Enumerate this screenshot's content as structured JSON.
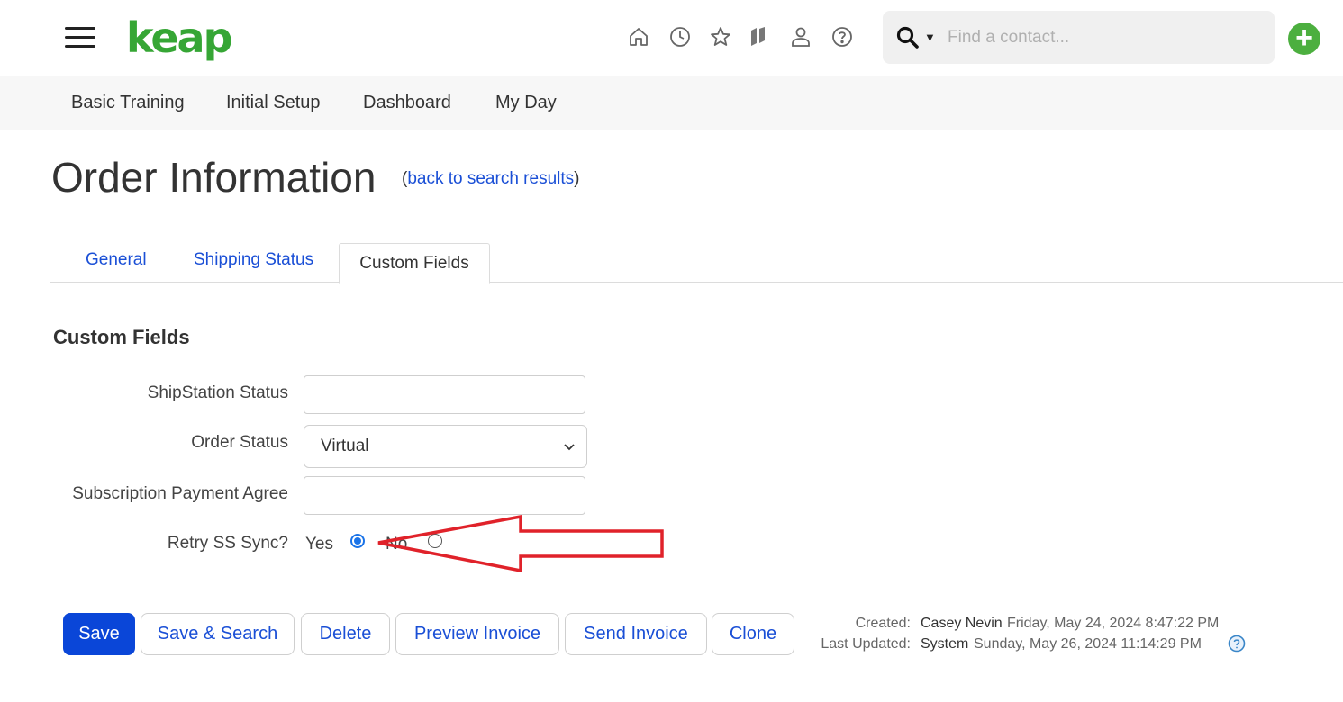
{
  "header": {
    "logo_text": "keap",
    "icons": [
      "home-icon",
      "history-icon",
      "star-icon",
      "tasks-icon",
      "person-icon",
      "help-icon"
    ],
    "search": {
      "placeholder": "Find a contact..."
    },
    "add_button": "+"
  },
  "nav": {
    "items": [
      "Basic Training",
      "Initial Setup",
      "Dashboard",
      "My Day"
    ]
  },
  "page": {
    "title": "Order Information",
    "back_paren_open": "(",
    "back_link": "back to search results",
    "back_paren_close": ")"
  },
  "tabs": {
    "items": [
      "General",
      "Shipping Status",
      "Custom Fields"
    ],
    "active": "Custom Fields"
  },
  "custom_fields": {
    "section_title": "Custom Fields",
    "shipstation_status": {
      "label": "ShipStation Status",
      "value": ""
    },
    "order_status": {
      "label": "Order Status",
      "value": "Virtual"
    },
    "subscription_payment": {
      "label": "Subscription Payment Agree",
      "value": ""
    },
    "retry_sync": {
      "label": "Retry SS Sync?",
      "yes_label": "Yes",
      "no_label": "No",
      "selected": "Yes"
    }
  },
  "buttons": {
    "save": "Save",
    "save_search": "Save & Search",
    "delete": "Delete",
    "preview_invoice": "Preview Invoice",
    "send_invoice": "Send Invoice",
    "clone": "Clone"
  },
  "meta": {
    "created_label": "Created:",
    "created_by": "Casey Nevin",
    "created_date": "Friday, May 24, 2024 8:47:22 PM",
    "updated_label": "Last Updated:",
    "updated_by": "System",
    "updated_date": "Sunday, May 26, 2024 11:14:29 PM"
  },
  "colors": {
    "brand_green": "#36a635",
    "link_blue": "#1a4fd6",
    "primary_button": "#0a46d8",
    "annotation_red": "#e0222a"
  }
}
